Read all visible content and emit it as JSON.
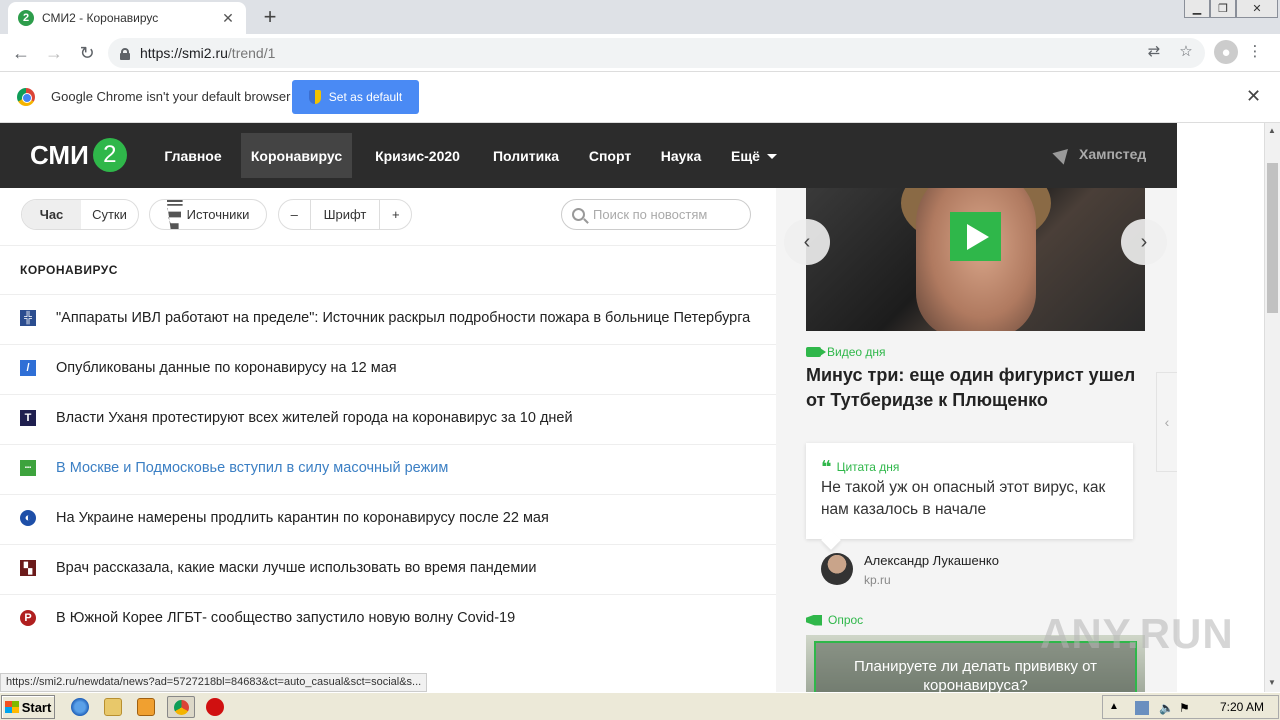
{
  "browser": {
    "tab_title": "СМИ2 - Коронавирус",
    "tab_favicon": "2",
    "tab_close": "✕",
    "new_tab": "+",
    "url_host": "https://smi2.ru",
    "url_path": "/trend/1",
    "infobar_text": "Google Chrome isn't your default browser",
    "set_default_label": "Set as default",
    "infobar_close": "✕"
  },
  "site": {
    "logo_text": "СМИ",
    "logo_number": "2",
    "nav": [
      {
        "label": "Главное"
      },
      {
        "label": "Коронавирус"
      },
      {
        "label": "Кризис-2020"
      },
      {
        "label": "Политика"
      },
      {
        "label": "Спорт"
      },
      {
        "label": "Наука"
      },
      {
        "label": "Ещё"
      }
    ],
    "location": "Хампстед"
  },
  "filters": {
    "hour": "Час",
    "day": "Сутки",
    "sources": "Источники",
    "font_minus": "–",
    "font_label": "Шрифт",
    "font_plus": "+",
    "search_placeholder": "Поиск по новостям"
  },
  "section_title": "КОРОНАВИРУС",
  "news": [
    {
      "text": "\"Аппараты ИВЛ работают на пределе\": Источник раскрыл подробности пожара в больнице Петербурга",
      "icon_color": "#2b4d8f",
      "icon_glyph": "╬"
    },
    {
      "text": "Опубликованы данные по коронавирусу на 12 мая",
      "icon_color": "#2f6fd6",
      "icon_glyph": "/"
    },
    {
      "text": "Власти Уханя протестируют всех жителей города на коронавирус за 10 дней",
      "icon_color": "#1f1f4f",
      "icon_glyph": "T"
    },
    {
      "text": "В Москве и Подмосковье вступил в силу масочный режим",
      "icon_color": "#3da33d",
      "icon_glyph": "▪▪▪"
    },
    {
      "text": "На Украине намерены продлить карантин по коронавирусу после 22 мая",
      "icon_color": "#1e4fa8",
      "icon_glyph": "◐"
    },
    {
      "text": "Врач рассказала, какие маски лучше использовать во время пандемии",
      "icon_color": "#6b1a1a",
      "icon_glyph": "▚"
    },
    {
      "text": "В Южной Корее ЛГБТ- сообщество запустило новую волну Covid-19",
      "icon_color": "#b01f1f",
      "icon_glyph": "Р"
    }
  ],
  "sidebar": {
    "video_tag": "Видео дня",
    "video_title": "Минус три: еще один фигурист ушел от Тутберидзе к Плющенко",
    "quote_tag": "Цитата дня",
    "quote_text": "Не такой уж он опасный этот вирус, как нам казалось в начале",
    "quote_author": "Александр Лукашенко",
    "quote_source": "kp.ru",
    "poll_tag": "Опрос",
    "poll_text": "Планируете ли делать прививку от коронавируса?"
  },
  "status_url": "https://smi2.ru/newdata/news?ad=5727218bl=84683&ct=auto_casual&sct=social&s...",
  "watermark": "ANY.RUN",
  "taskbar": {
    "start_label": "Start",
    "clock": "7:20 AM"
  },
  "colors": {
    "brand_green": "#2fb74a",
    "header_dark": "#2c2c2c",
    "link_blue": "#3b7fc4"
  }
}
